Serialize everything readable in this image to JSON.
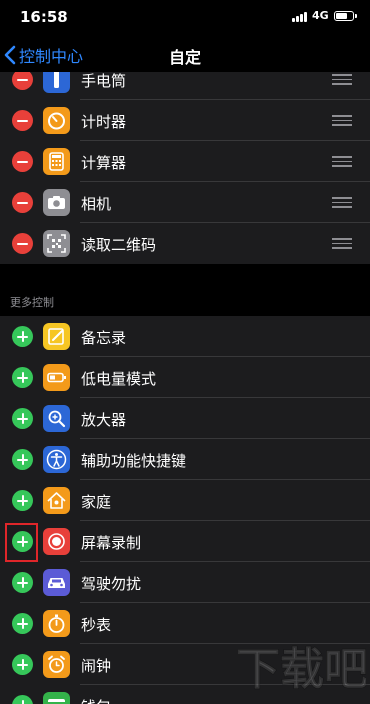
{
  "status": {
    "time": "16:58",
    "network": "4G"
  },
  "nav": {
    "back_label": "控制中心",
    "title": "自定"
  },
  "included": [
    {
      "label": "手电筒",
      "icon": "flashlight-icon",
      "color": "#2c67d6"
    },
    {
      "label": "计时器",
      "icon": "timer-icon",
      "color": "#f39a1a"
    },
    {
      "label": "计算器",
      "icon": "calculator-icon",
      "color": "#f39a1a"
    },
    {
      "label": "相机",
      "icon": "camera-icon",
      "color": "#8e8e93"
    },
    {
      "label": "读取二维码",
      "icon": "qr-code-icon",
      "color": "#8e8e93"
    }
  ],
  "more_controls": {
    "header": "更多控制",
    "items": [
      {
        "label": "备忘录",
        "icon": "notes-icon",
        "color": "#f6c623"
      },
      {
        "label": "低电量模式",
        "icon": "low-power-icon",
        "color": "#f39a1a"
      },
      {
        "label": "放大器",
        "icon": "magnifier-icon",
        "color": "#2c67d6"
      },
      {
        "label": "辅助功能快捷键",
        "icon": "accessibility-icon",
        "color": "#2c67d6"
      },
      {
        "label": "家庭",
        "icon": "home-icon",
        "color": "#f39a1a"
      },
      {
        "label": "屏幕录制",
        "icon": "screen-record-icon",
        "color": "#e8403a"
      },
      {
        "label": "驾驶勿扰",
        "icon": "car-icon",
        "color": "#5b5bd6"
      },
      {
        "label": "秒表",
        "icon": "stopwatch-icon",
        "color": "#f39a1a"
      },
      {
        "label": "闹钟",
        "icon": "alarm-icon",
        "color": "#f39a1a"
      },
      {
        "label": "钱包",
        "icon": "wallet-icon",
        "color": "#34b34a"
      }
    ]
  },
  "watermark": "下载吧"
}
